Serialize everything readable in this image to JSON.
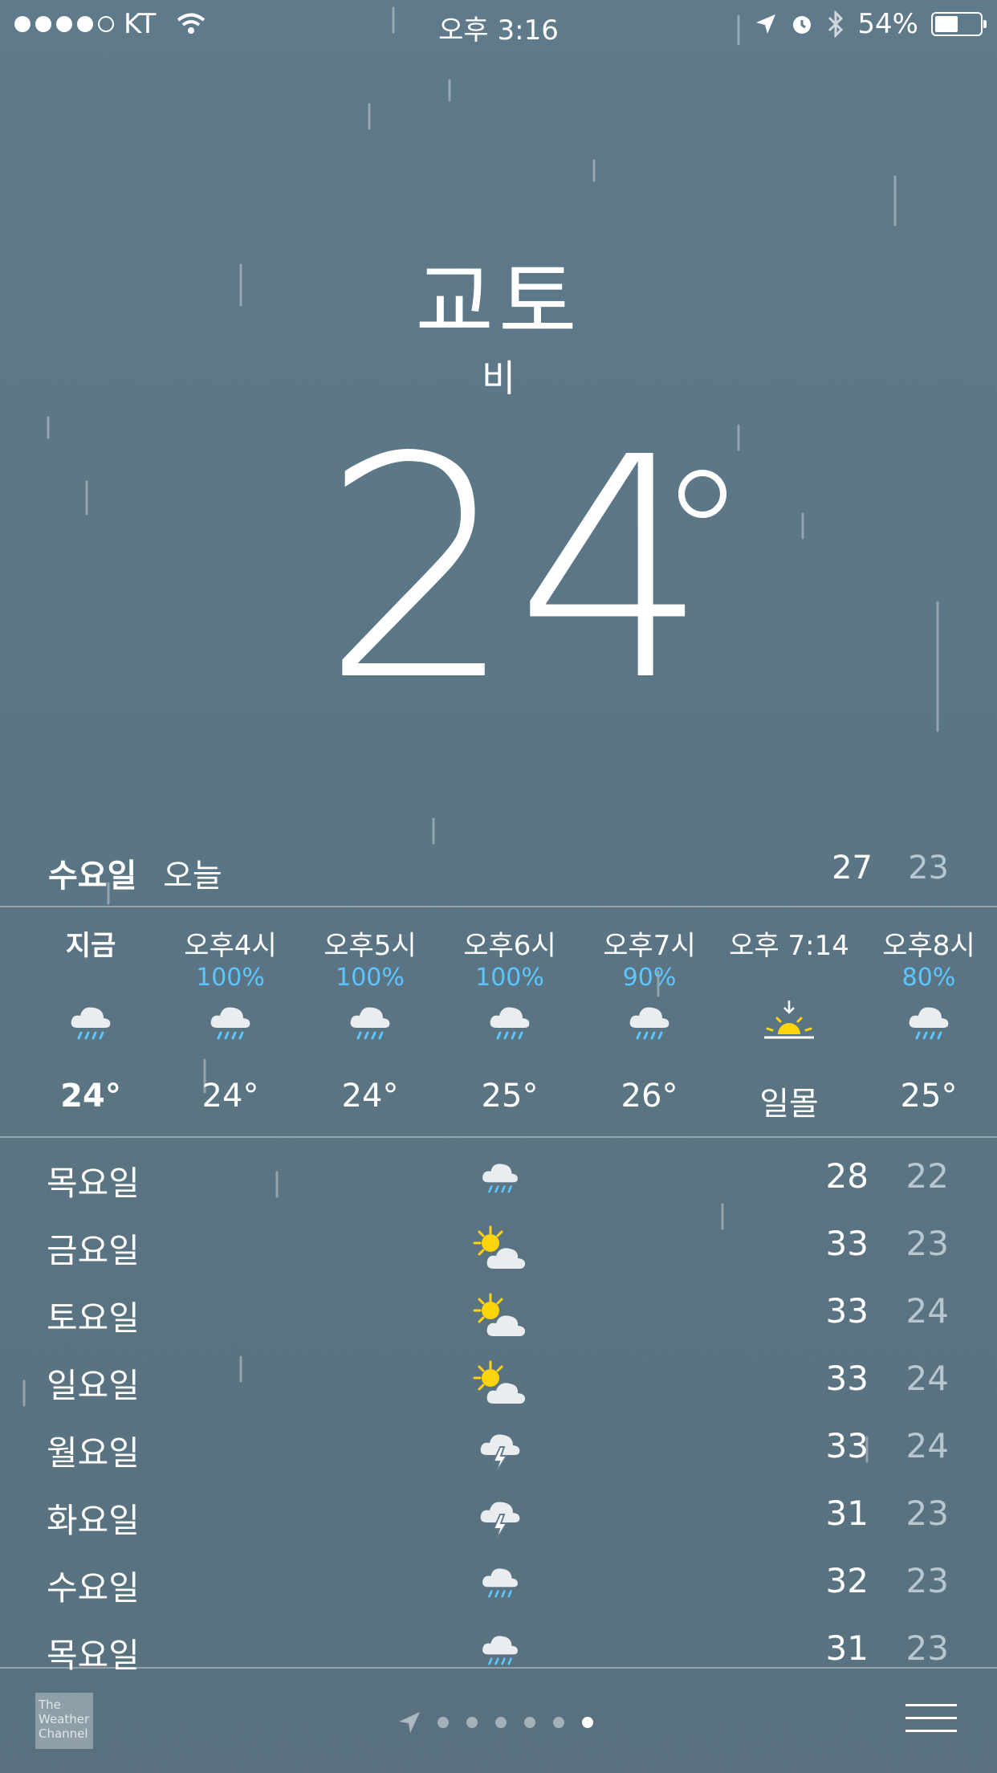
{
  "status_bar": {
    "carrier": "KT",
    "time": "오후 3:16",
    "battery": "54%",
    "battery_level": 0.54
  },
  "header": {
    "city": "교토",
    "condition": "비",
    "temperature": "24"
  },
  "today": {
    "day": "수요일",
    "label": "오늘",
    "high": "27",
    "low": "23"
  },
  "hourly": [
    {
      "time": "지금",
      "precip": "",
      "icon": "rain-cloud-icon",
      "temp": "24°"
    },
    {
      "time": "오후4시",
      "precip": "100%",
      "icon": "rain-cloud-icon",
      "temp": "24°"
    },
    {
      "time": "오후5시",
      "precip": "100%",
      "icon": "rain-cloud-icon",
      "temp": "24°"
    },
    {
      "time": "오후6시",
      "precip": "100%",
      "icon": "rain-cloud-icon",
      "temp": "25°"
    },
    {
      "time": "오후7시",
      "precip": "90%",
      "icon": "rain-cloud-icon",
      "temp": "26°"
    },
    {
      "time": "오후 7:14",
      "precip": "",
      "icon": "sunset-icon",
      "temp": "일몰"
    },
    {
      "time": "오후8시",
      "precip": "80%",
      "icon": "rain-cloud-icon",
      "temp": "25°"
    }
  ],
  "daily": [
    {
      "day": "목요일",
      "icon": "rain-cloud-icon",
      "high": "28",
      "low": "22"
    },
    {
      "day": "금요일",
      "icon": "partly-sunny-icon",
      "high": "33",
      "low": "23"
    },
    {
      "day": "토요일",
      "icon": "partly-sunny-icon",
      "high": "33",
      "low": "24"
    },
    {
      "day": "일요일",
      "icon": "partly-sunny-icon",
      "high": "33",
      "low": "24"
    },
    {
      "day": "월요일",
      "icon": "thunderstorm-icon",
      "high": "33",
      "low": "24"
    },
    {
      "day": "화요일",
      "icon": "thunderstorm-icon",
      "high": "31",
      "low": "23"
    },
    {
      "day": "수요일",
      "icon": "rain-cloud-icon",
      "high": "32",
      "low": "23"
    },
    {
      "day": "목요일",
      "icon": "rain-cloud-icon",
      "high": "31",
      "low": "23"
    }
  ],
  "footer": {
    "logo_text": "The Weather Channel",
    "pages": 6,
    "current_page": 6
  },
  "colors": {
    "precip": "#5bc6ff",
    "sun": "#ffd40a",
    "low_temp": "#b7c6cf"
  }
}
